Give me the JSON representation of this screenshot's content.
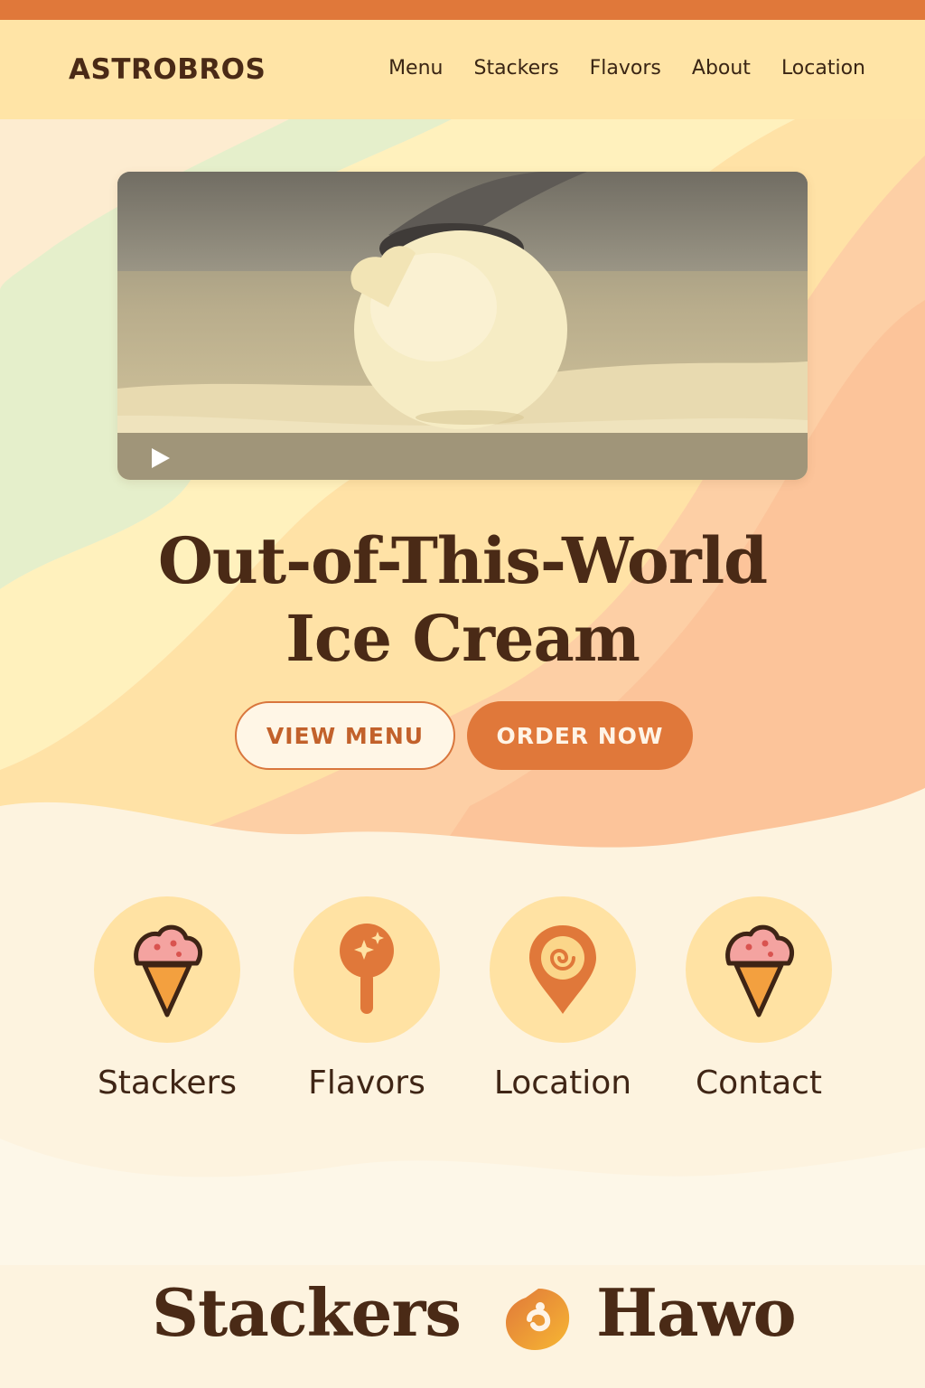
{
  "brand": {
    "name": "ASTROBROS"
  },
  "nav": {
    "items": [
      {
        "label": "Menu"
      },
      {
        "label": "Stackers"
      },
      {
        "label": "Flavors"
      },
      {
        "label": "About"
      },
      {
        "label": "Location"
      }
    ]
  },
  "hero": {
    "video": {
      "play_icon": "play-icon"
    },
    "headline_line1": "Out-of-This-World",
    "headline_line2": "Ice Cream",
    "buttons": {
      "view_menu": "VIEW MENU",
      "order_now": "ORDER NOW"
    }
  },
  "features": [
    {
      "label": "Stackers",
      "icon": "ice-cream-cone-icon"
    },
    {
      "label": "Flavors",
      "icon": "ice-cream-scoop-icon"
    },
    {
      "label": "Location",
      "icon": "location-pin-icon"
    },
    {
      "label": "Contact",
      "icon": "ice-cream-cone-icon"
    }
  ],
  "footer_heading": {
    "left": "Stackers",
    "right": "Hawo"
  },
  "colors": {
    "accent": "#e0783a",
    "text_dark": "#4a2a16",
    "header_bg": "#ffe4a6",
    "page_bg": "#fdf3df"
  }
}
